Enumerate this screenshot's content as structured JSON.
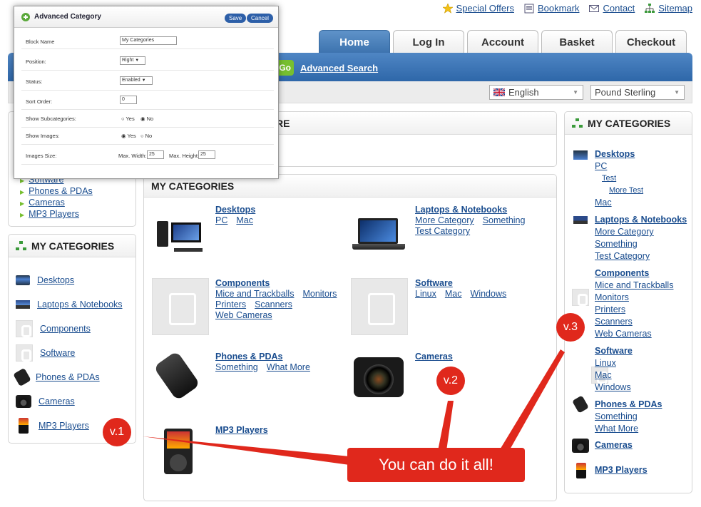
{
  "top_links": [
    {
      "label": "Special Offers",
      "icon": "star-icon"
    },
    {
      "label": "Bookmark",
      "icon": "bookmark-icon"
    },
    {
      "label": "Contact",
      "icon": "mail-icon"
    },
    {
      "label": "Sitemap",
      "icon": "sitemap-icon"
    }
  ],
  "tabs": [
    "Home",
    "Log In",
    "Account",
    "Basket",
    "Checkout"
  ],
  "search": {
    "go_label": "Go",
    "advanced_label": "Advanced Search"
  },
  "language": "English",
  "currency": "Pound Sterling",
  "dialog": {
    "title": "Advanced Category",
    "save_label": "Save",
    "cancel_label": "Cancel",
    "rows": {
      "block_name": {
        "label": "Block Name",
        "value": "My Categories"
      },
      "position": {
        "label": "Position:",
        "value": "Right"
      },
      "status": {
        "label": "Status:",
        "value": "Enabled"
      },
      "sort_order": {
        "label": "Sort Order:",
        "value": "0"
      },
      "show_subcategories": {
        "label": "Show Subcategories:",
        "yes": "Yes",
        "no": "No"
      },
      "show_images": {
        "label": "Show Images:",
        "yes": "Yes",
        "no": "No"
      },
      "images_size": {
        "label": "Images Size:",
        "max_width_label": "Max. Width:",
        "max_width": "25",
        "max_height_label": "Max. Height:",
        "max_height": "25"
      }
    }
  },
  "partial_heading": "RE",
  "left_top_list": [
    "Software",
    "Phones & PDAs",
    "Cameras",
    "MP3 Players"
  ],
  "left_box": {
    "title": "MY CATEGORIES",
    "items": [
      "Desktops",
      "Laptops & Notebooks",
      "Components",
      "Software",
      "Phones & PDAs",
      "Cameras",
      "MP3 Players"
    ]
  },
  "main": {
    "title": "MY CATEGORIES",
    "items": [
      {
        "title": "Desktops",
        "subs": [
          "PC",
          "Mac"
        ]
      },
      {
        "title": "Laptops & Notebooks",
        "subs": [
          "More Category",
          "Something",
          "Test Category"
        ]
      },
      {
        "title": "Components",
        "subs": [
          "Mice and Trackballs",
          "Monitors",
          "Printers",
          "Scanners",
          "Web Cameras"
        ]
      },
      {
        "title": "Software",
        "subs": [
          "Linux",
          "Mac",
          "Windows"
        ]
      },
      {
        "title": "Phones & PDAs",
        "subs": [
          "Something",
          "What More"
        ]
      },
      {
        "title": "Cameras",
        "subs": []
      },
      {
        "title": "MP3 Players",
        "subs": []
      }
    ]
  },
  "right_box": {
    "title": "MY CATEGORIES",
    "desktops": {
      "title": "Desktops",
      "pc": "PC",
      "test": "Test",
      "more_test": "More Test",
      "mac": "Mac"
    },
    "laptops": {
      "title": "Laptops & Notebooks",
      "subs": [
        "More Category",
        "Something",
        "Test Category"
      ]
    },
    "components": {
      "title": "Components",
      "subs": [
        "Mice and Trackballs",
        "Monitors",
        "Printers",
        "Scanners",
        "Web Cameras"
      ]
    },
    "software": {
      "title": "Software",
      "subs": [
        "Linux",
        "Mac",
        "Windows"
      ]
    },
    "phones": {
      "title": "Phones & PDAs",
      "subs": [
        "Something",
        "What More"
      ]
    },
    "cameras": "Cameras",
    "mp3": "MP3 Players"
  },
  "annotations": {
    "v1": "v.1",
    "v2": "v.2",
    "v3": "v.3",
    "callout": "You can do it all!"
  },
  "colors": {
    "accent": "#3c72ae",
    "callout": "#e0281c",
    "link": "#1a4d8f"
  }
}
